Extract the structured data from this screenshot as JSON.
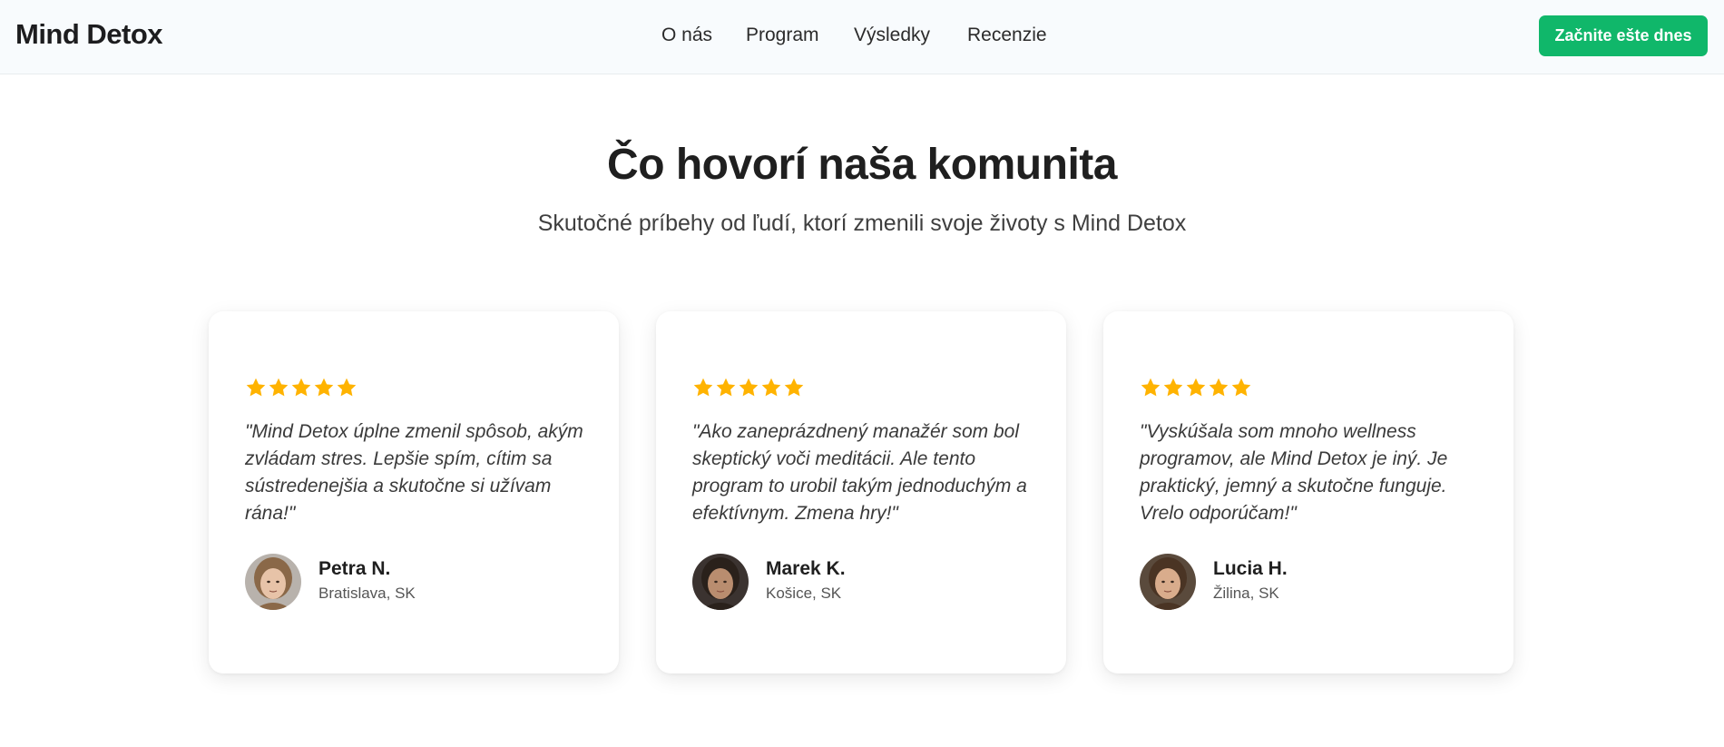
{
  "header": {
    "logo": "Mind Detox",
    "nav": [
      {
        "label": "O nás"
      },
      {
        "label": "Program"
      },
      {
        "label": "Výsledky"
      },
      {
        "label": "Recenzie"
      }
    ],
    "cta_label": "Začnite ešte dnes"
  },
  "section": {
    "title": "Čo hovorí naša komunita",
    "subtitle": "Skutočné príbehy od ľudí, ktorí zmenili svoje životy s Mind Detox"
  },
  "testimonials": [
    {
      "rating": 5,
      "quote": "\"Mind Detox úplne zmenil spôsob, akým zvládam stres. Lepšie spím, cítim sa sústredenejšia a skutočne si užívam rána!\"",
      "name": "Petra N.",
      "location": "Bratislava, SK",
      "avatar": {
        "skin": "#e7c3a8",
        "hair": "#8a6848",
        "bg": "#b8b2ac"
      }
    },
    {
      "rating": 5,
      "quote": "\"Ako zaneprázdnený manažér som bol skeptický voči meditácii. Ale tento program to urobil takým jednoduchým a efektívnym. Zmena hry!\"",
      "name": "Marek K.",
      "location": "Košice, SK",
      "avatar": {
        "skin": "#b98d6f",
        "hair": "#2a211b",
        "bg": "#3b3330"
      }
    },
    {
      "rating": 5,
      "quote": "\"Vyskúšala som mnoho wellness programov, ale Mind Detox je iný. Je praktický, jemný a skutočne funguje. Vrelo odporúčam!\"",
      "name": "Lucia H.",
      "location": "Žilina, SK",
      "avatar": {
        "skin": "#d9ac8c",
        "hair": "#4a3424",
        "bg": "#5a4a3c"
      }
    }
  ],
  "colors": {
    "accent": "#10b76a",
    "star": "#ffb300",
    "text": "#1f1f1f",
    "muted": "#555555"
  },
  "icons": {
    "star": "star-icon"
  }
}
